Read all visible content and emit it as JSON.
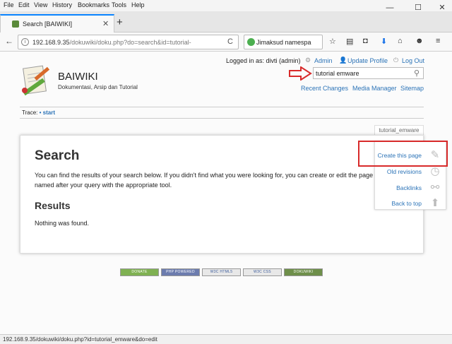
{
  "menu": [
    "File",
    "Edit",
    "View",
    "History",
    "Bookmarks",
    "Tools",
    "Help"
  ],
  "window_controls": {
    "minimize": "—",
    "maximize": "☐",
    "close": "✕"
  },
  "tab": {
    "title": "Search [BAIWIKI]",
    "close": "✕",
    "new_tab": "+"
  },
  "nav": {
    "back": "←",
    "reload": "C",
    "url_host": "192.168.9.35",
    "url_path": "/dokuwiki/doku.php?do=search&id=tutorial-",
    "search_query": "Jimaksud namespa",
    "toolbar_icons": [
      "star-icon",
      "clipboard-icon",
      "pocket-icon",
      "download-icon",
      "home-icon",
      "chat-icon",
      "menu-icon"
    ]
  },
  "user": {
    "logged_in": "Logged in as: divti (admin)",
    "admin": "Admin",
    "update_profile": "Update Profile",
    "logout": "Log Out"
  },
  "site": {
    "title": "BAIWIKI",
    "tagline": "Dokumentasi, Arsip dan Tutorial"
  },
  "quicksearch": {
    "value": "tutorial emware"
  },
  "links": {
    "recent": "Recent Changes",
    "media": "Media Manager",
    "sitemap": "Sitemap"
  },
  "trace": {
    "label": "Trace:",
    "sep": "•",
    "item": "start"
  },
  "page_id": "tutorial_emware",
  "content": {
    "heading": "Search",
    "intro": "You can find the results of your search below. If you didn't find what you were looking for, you can create or edit the page named after your query with the appropriate tool.",
    "results_heading": "Results",
    "nothing": "Nothing was found."
  },
  "pagetools": {
    "create": "Create this page",
    "revisions": "Old revisions",
    "backlinks": "Backlinks",
    "top": "Back to top"
  },
  "badges": [
    {
      "label": "DONATE",
      "color": "#7fb152"
    },
    {
      "label": "PHP POWERED",
      "color": "#6c7cae"
    },
    {
      "label": "W3C HTML5",
      "color": "#e8e8e8"
    },
    {
      "label": "W3C CSS",
      "color": "#e8e8e8"
    },
    {
      "label": "DOKUWIKI",
      "color": "#6e8f4a"
    }
  ],
  "status_url": "192.168.9.35/dokuwiki/doku.php?id=tutorial_emware&do=edit",
  "accent": "#d82a2a"
}
